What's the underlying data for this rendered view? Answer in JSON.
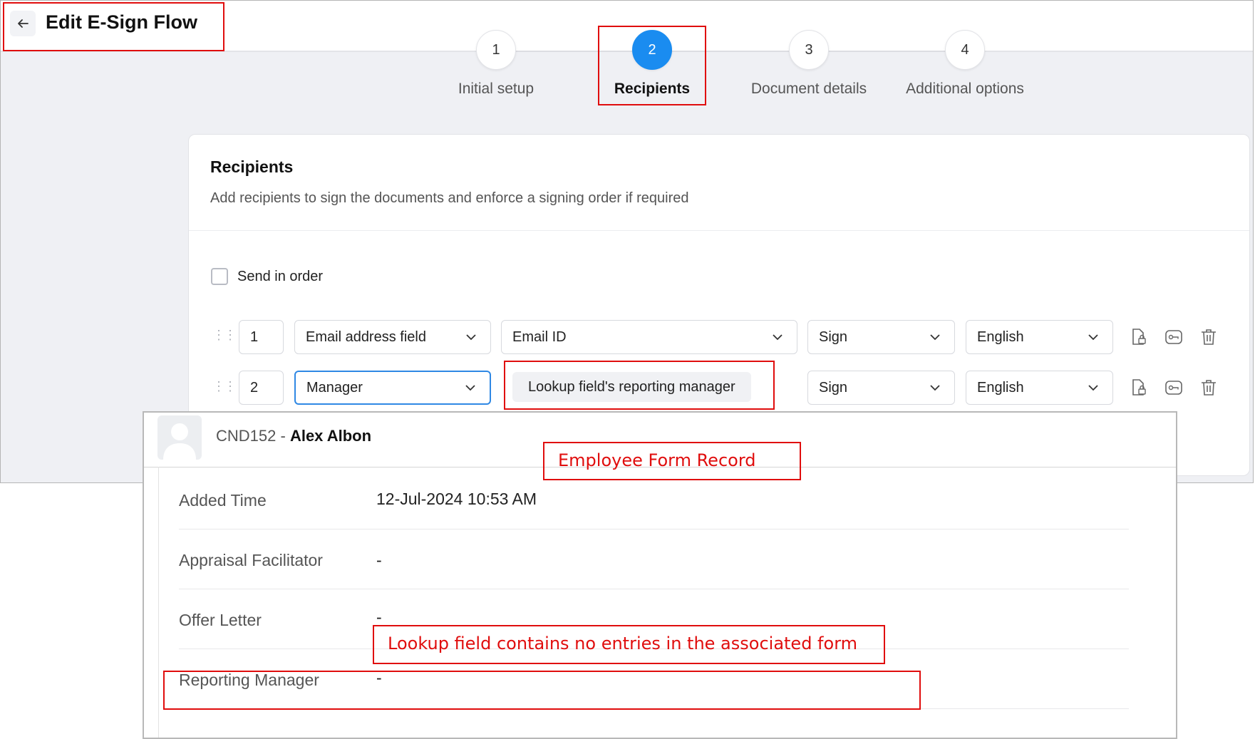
{
  "header": {
    "back_icon": "arrow-left-icon",
    "title": "Edit E-Sign Flow"
  },
  "steps": [
    {
      "number": "1",
      "label": "Initial setup",
      "active": false
    },
    {
      "number": "2",
      "label": "Recipients",
      "active": true
    },
    {
      "number": "3",
      "label": "Document details",
      "active": false
    },
    {
      "number": "4",
      "label": "Additional options",
      "active": false
    }
  ],
  "recipients_card": {
    "title": "Recipients",
    "subtitle": "Add recipients to sign the documents and enforce a signing order if required",
    "send_in_order": {
      "label": "Send in order",
      "checked": false
    },
    "rows": [
      {
        "order": "1",
        "type": "Email address field",
        "value": "Email ID",
        "action": "Sign",
        "language": "English"
      },
      {
        "order": "2",
        "type": "Manager",
        "value": "Lookup field's reporting manager",
        "action": "Sign",
        "language": "English"
      }
    ],
    "row_icons": [
      "document-lock-icon",
      "key-icon",
      "trash-icon"
    ]
  },
  "record_panel": {
    "record_id": "CND152 -",
    "record_name": "Alex Albon",
    "fields": [
      {
        "label": "Added Time",
        "value": "12-Jul-2024 10:53 AM"
      },
      {
        "label": "Appraisal Facilitator",
        "value": "-"
      },
      {
        "label": "Offer Letter",
        "value": "-"
      },
      {
        "label": "Reporting Manager",
        "value": "-"
      }
    ]
  },
  "annotations": {
    "employee_form_record": "Employee Form Record",
    "lookup_note": "Lookup field contains no entries in the associated form"
  },
  "colors": {
    "accent": "#1a8cf0",
    "annotation": "#e00d0d",
    "background": "#eff0f4"
  }
}
